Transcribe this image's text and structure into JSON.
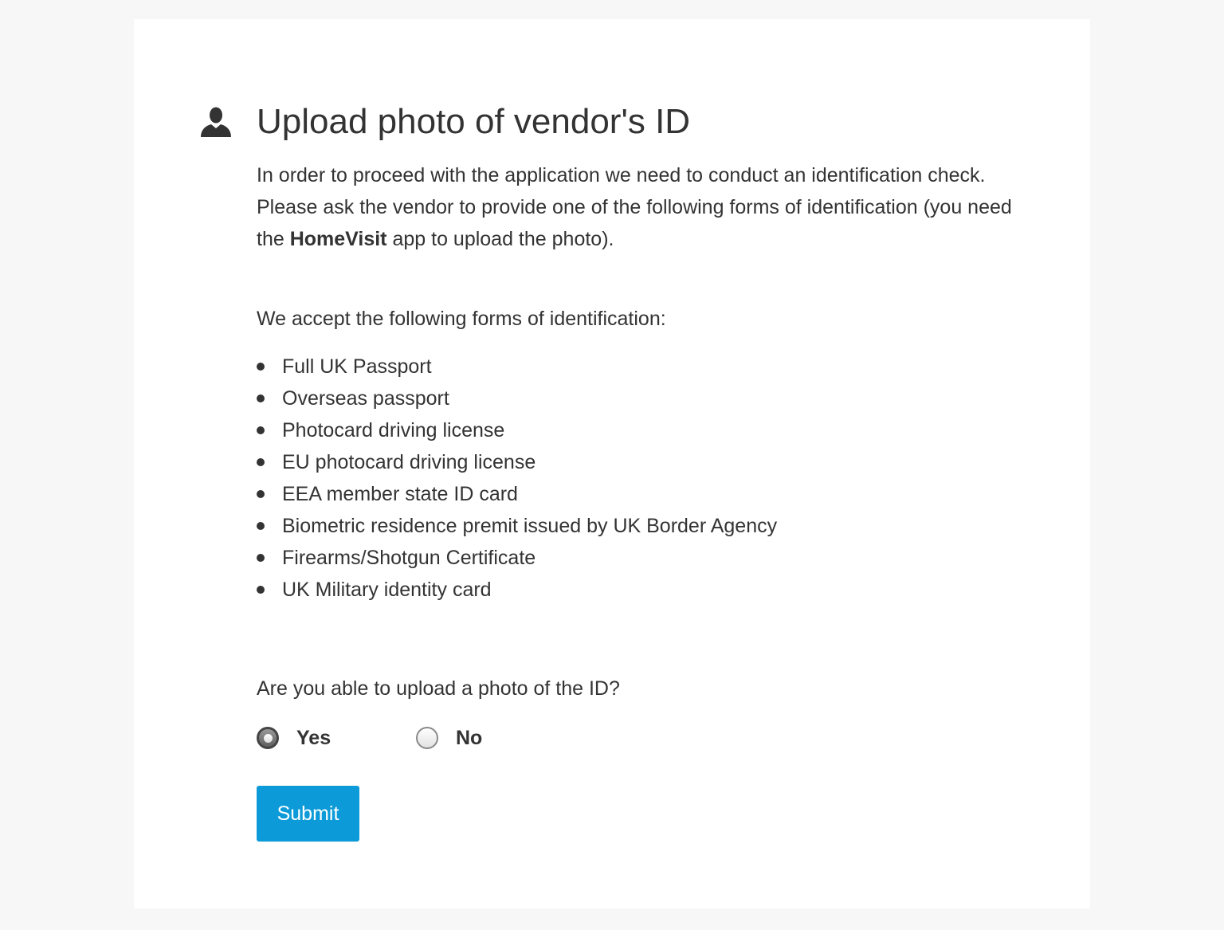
{
  "header": {
    "icon": "person-icon",
    "title": "Upload photo of vendor's ID"
  },
  "intro": {
    "line1": "In order to proceed with the application we need to conduct an identification check.",
    "line2_before": "Please ask the vendor to provide one of the following forms of identification (you need the ",
    "line2_app": "HomeVisit",
    "line2_after": " app to upload the photo)."
  },
  "accept_label": "We accept the following forms of identification:",
  "id_forms": [
    "Full UK Passport",
    "Overseas passport",
    "Photocard driving license",
    "EU photocard driving license",
    "EEA member state ID card",
    "Biometric residence premit issued by UK Border Agency",
    "Firearms/Shotgun Certificate",
    "UK Military identity card"
  ],
  "question": {
    "text": "Are you able to upload a photo of the ID?",
    "options": [
      {
        "label": "Yes",
        "selected": true
      },
      {
        "label": "No",
        "selected": false
      }
    ]
  },
  "submit": {
    "label": "Submit",
    "color": "#0c9bd8"
  }
}
